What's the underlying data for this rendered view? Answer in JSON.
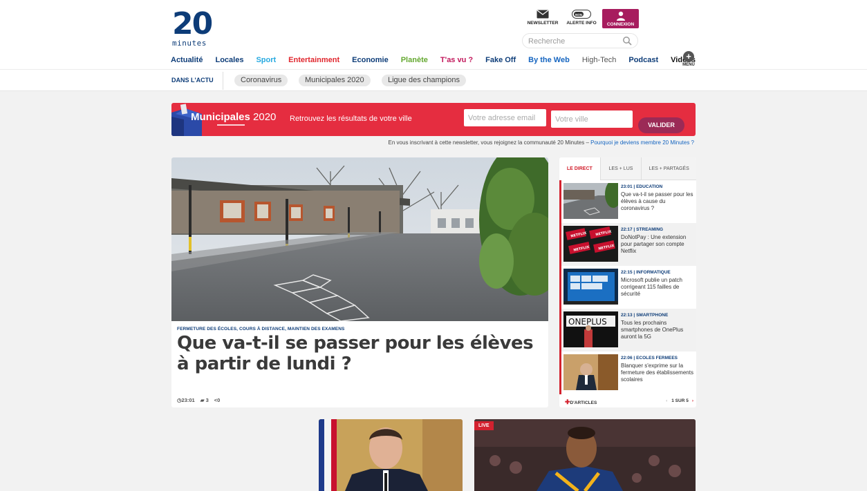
{
  "header": {
    "logo_digits": "20",
    "logo_word": "minutes",
    "newsletter_label": "NEWSLETTER",
    "alerte_label": "ALERTE INFO",
    "alerte_toggle": "NON",
    "connexion_label": "CONNEXION",
    "search_placeholder": "Recherche",
    "menu_label": "MENU"
  },
  "nav": [
    {
      "label": "Actualité",
      "color": "#0d3c78"
    },
    {
      "label": "Locales",
      "color": "#0d3c78"
    },
    {
      "label": "Sport",
      "color": "#26a9e0"
    },
    {
      "label": "Entertainment",
      "color": "#e0262d"
    },
    {
      "label": "Economie",
      "color": "#0d3c78"
    },
    {
      "label": "Planète",
      "color": "#64a830"
    },
    {
      "label": "T'as vu ?",
      "color": "#c2185b"
    },
    {
      "label": "Fake Off",
      "color": "#0d3c78"
    },
    {
      "label": "By the Web",
      "color": "#1565c0"
    },
    {
      "label": "High-Tech",
      "color": "#555555"
    },
    {
      "label": "Podcast",
      "color": "#0d3c78"
    },
    {
      "label": "Vidéos",
      "color": "#111111"
    }
  ],
  "trend": {
    "label": "DANS L'ACTU",
    "pills": [
      "Coronavirus",
      "Municipales 2020",
      "Ligue des champions"
    ]
  },
  "banner": {
    "title_bold": "Municipales",
    "title_year": "2020",
    "tagline": "Retrouvez les résultats de votre ville",
    "email_placeholder": "Votre adresse email",
    "city_placeholder": "Votre ville",
    "button": "VALIDER",
    "disclaimer_text": "En vous inscrivant à cette newsletter, vous rejoignez la communauté 20 Minutes – ",
    "disclaimer_link": "Pourquoi je deviens membre 20 Minutes ?"
  },
  "main_article": {
    "kicker": "FERMETURE DES ÉCOLES, COURS À DISTANCE, MAINTIEN DES EXAMENS",
    "headline_line1": "Que va-t-il se passer pour les élèves",
    "headline_line2": "à partir de lundi ?",
    "time": "23:01",
    "comments": "3",
    "shares": "0"
  },
  "sidebar": {
    "tabs": [
      "LE DIRECT",
      "LES + LUS",
      "LES + PARTAGÉS"
    ],
    "items": [
      {
        "time": "23:01",
        "category": "EDUCATION",
        "title": "Que va-t-il se passer pour les élèves à cause du coronavirus ?"
      },
      {
        "time": "22:17",
        "category": "STREAMING",
        "title": "DoNotPay : Une extension pour partager son compte Netflix"
      },
      {
        "time": "22:15",
        "category": "INFORMATIQUE",
        "title": "Microsoft publie un patch corrigeant 115 failles de sécurité"
      },
      {
        "time": "22:13",
        "category": "SMARTPHONE",
        "title": "Tous les prochains smartphones de OnePlus auront la 5G"
      },
      {
        "time": "22:06",
        "category": "ECOLES FERMEES",
        "title": "Blanquer s'exprime sur la fermeture des établissements scolaires"
      }
    ],
    "more_label": "D'ARTICLES",
    "pager": "1 SUR 5"
  },
  "bottom": {
    "live_badge": "LIVE"
  }
}
